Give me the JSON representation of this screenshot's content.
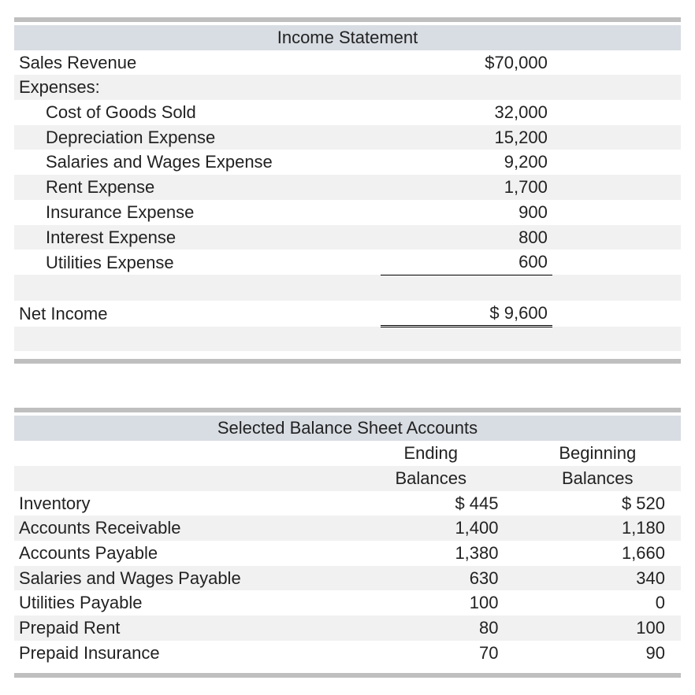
{
  "income": {
    "title": "Income Statement",
    "sales_label": "Sales Revenue",
    "sales_value": "$70,000",
    "expenses_header": "Expenses:",
    "expenses": [
      {
        "label": "Cost of Goods Sold",
        "value": "32,000"
      },
      {
        "label": "Depreciation Expense",
        "value": "15,200"
      },
      {
        "label": "Salaries and Wages Expense",
        "value": "9,200"
      },
      {
        "label": "Rent Expense",
        "value": "1,700"
      },
      {
        "label": "Insurance Expense",
        "value": "900"
      },
      {
        "label": "Interest Expense",
        "value": "800"
      },
      {
        "label": "Utilities Expense",
        "value": "600"
      }
    ],
    "net_label": "Net Income",
    "net_value": "$ 9,600"
  },
  "balance": {
    "title": "Selected Balance Sheet Accounts",
    "col1_a": "Ending",
    "col1_b": "Balances",
    "col2_a": "Beginning",
    "col2_b": "Balances",
    "rows": [
      {
        "label": "Inventory",
        "end": "$  445",
        "beg": "$  520"
      },
      {
        "label": "Accounts Receivable",
        "end": "1,400",
        "beg": "1,180"
      },
      {
        "label": "Accounts Payable",
        "end": "1,380",
        "beg": "1,660"
      },
      {
        "label": "Salaries and Wages Payable",
        "end": "630",
        "beg": "340"
      },
      {
        "label": "Utilities Payable",
        "end": "100",
        "beg": "0"
      },
      {
        "label": "Prepaid Rent",
        "end": "80",
        "beg": "100"
      },
      {
        "label": "Prepaid Insurance",
        "end": "70",
        "beg": "90"
      }
    ]
  }
}
